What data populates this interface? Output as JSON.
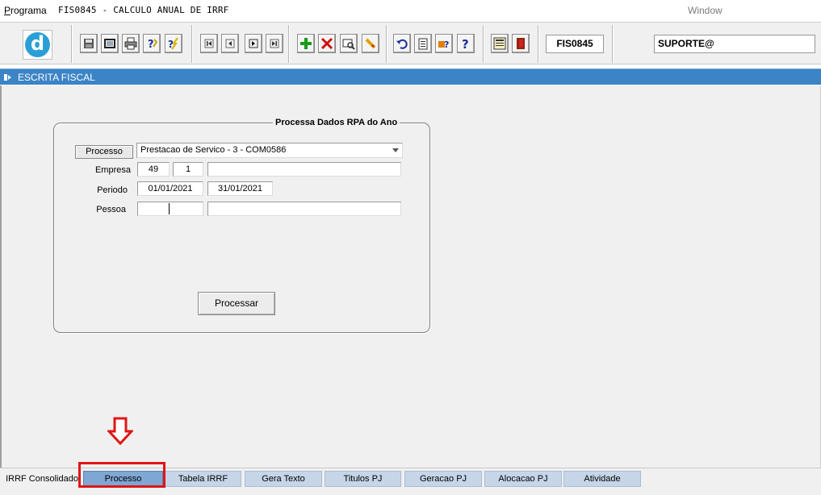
{
  "titlebar": {
    "menu_programa": "Programa",
    "title": "FIS0845 - CALCULO ANUAL DE IRRF",
    "menu_window": "Window"
  },
  "toolbar": {
    "logo_letter": "d",
    "program_code": "FIS0845",
    "user": "SUPORTE@",
    "icons": [
      "save-icon",
      "window-icon",
      "print-icon",
      "help-query-icon",
      "execute-icon",
      "first-record-icon",
      "previous-record-icon",
      "next-record-icon",
      "last-record-icon",
      "insert-record-icon",
      "delete-record-icon",
      "search-record-icon",
      "clear-icon",
      "undo-icon",
      "clipboard-icon",
      "tools-icon",
      "help-icon",
      "menu-icon",
      "exit-icon"
    ]
  },
  "header": {
    "title": "ESCRITA FISCAL"
  },
  "form": {
    "frame_title": "Processa Dados RPA do Ano",
    "processo_label": "Processo",
    "processo_value": "Prestacao de Servico - 3 - COM0586",
    "empresa_label": "Empresa",
    "empresa_code": "49",
    "empresa_branch": "1",
    "empresa_name": "",
    "periodo_label": "Periodo",
    "periodo_start": "01/01/2021",
    "periodo_end": "31/01/2021",
    "pessoa_label": "Pessoa",
    "pessoa_code": "",
    "pessoa_name": "",
    "processar_label": "Processar"
  },
  "tabs": [
    {
      "label": "IRRF Consolidado"
    },
    {
      "label": "Processo"
    },
    {
      "label": "Tabela IRRF"
    },
    {
      "label": "Gera Texto"
    },
    {
      "label": "Titulos PJ"
    },
    {
      "label": "Geracao PJ"
    },
    {
      "label": "Alocacao PJ"
    },
    {
      "label": "Atividade"
    }
  ],
  "colors": {
    "header_blue": "#3b84c6",
    "tab_blue": "#c6d6e8",
    "tab_active": "#7fa7d3",
    "annotation_red": "#e01515"
  }
}
